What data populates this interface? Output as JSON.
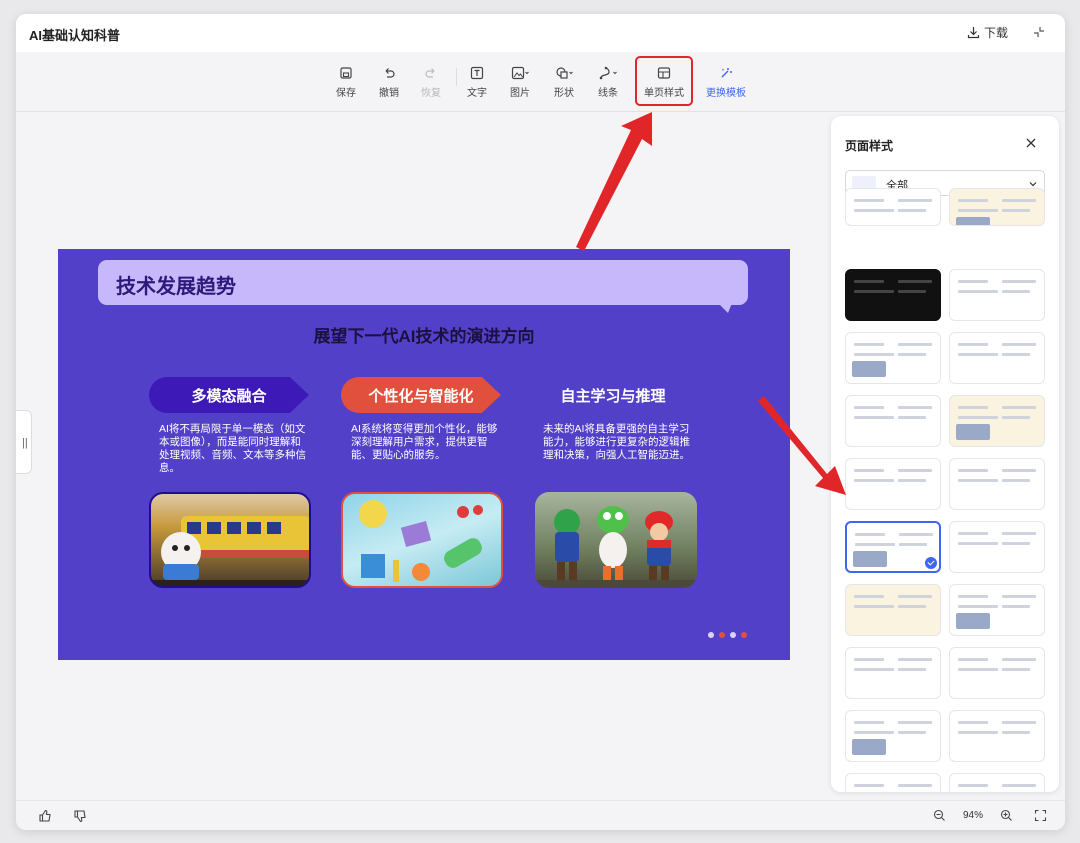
{
  "app": {
    "title": "AI基础认知科普",
    "download_label": "下载"
  },
  "toolbar": {
    "save": "保存",
    "undo": "撤销",
    "redo": "恢复",
    "text": "文字",
    "image": "图片",
    "shape": "形状",
    "line": "线条",
    "single_page_style": "单页样式",
    "change_template": "更换模板"
  },
  "slide": {
    "title": "技术发展趋势",
    "subtitle": "展望下一代AI技术的演进方向",
    "columns": [
      {
        "heading": "多模态融合",
        "text": "AI将不再局限于单一模态（如文本或图像），而是能同时理解和处理视频、音频、文本等多种信息。"
      },
      {
        "heading": "个性化与智能化",
        "text": "AI系统将变得更加个性化，能够深刻理解用户需求，提供更智能、更贴心的服务。"
      },
      {
        "heading": "自主学习与推理",
        "text": "未来的AI将具备更强的自主学习能力，能够进行更复杂的逻辑推理和决策，向强人工智能迈进。"
      }
    ],
    "dot_colors": [
      "#d9d4f5",
      "#e0503d",
      "#d9d4f5",
      "#e0503d"
    ]
  },
  "panel": {
    "title": "页面样式",
    "filter_value": "全部"
  },
  "zoom": {
    "value": "94%"
  },
  "colors": {
    "accent": "#3e66f2",
    "highlight": "#e1262a",
    "slide_bg": "#5340c8",
    "banner": "#c7b8fb"
  }
}
